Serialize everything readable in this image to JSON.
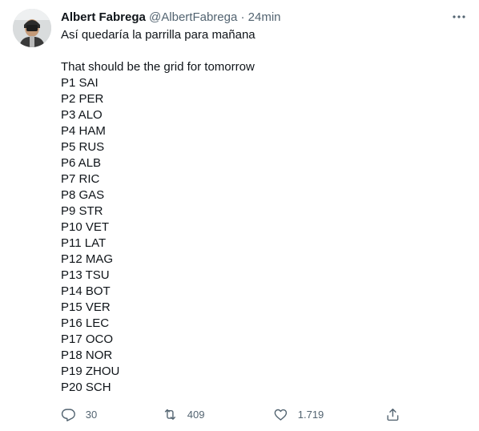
{
  "tweet": {
    "author": {
      "name": "Albert Fabrega",
      "handle": "@AlbertFabrega",
      "separator": "·",
      "time": "24min"
    },
    "text_line_1": "Así quedaría la parrilla para mañana",
    "text_line_2": "That should be the grid for tomorrow",
    "grid": [
      "P1 SAI",
      "P2 PER",
      "P3 ALO",
      "P4 HAM",
      "P5 RUS",
      "P6 ALB",
      "P7 RIC",
      "P8 GAS",
      "P9 STR",
      "P10 VET",
      "P11 LAT",
      "P12 MAG",
      "P13 TSU",
      "P14 BOT",
      "P15 VER",
      "P16 LEC",
      "P17 OCO",
      "P18 NOR",
      "P19 ZHOU",
      "P20 SCH"
    ],
    "actions": {
      "reply_count": "30",
      "retweet_count": "409",
      "like_count": "1.719"
    },
    "icons": {
      "more": "more-horizontal-icon",
      "reply": "reply-icon",
      "retweet": "retweet-icon",
      "like": "heart-icon",
      "share": "share-icon"
    },
    "colors": {
      "text": "#0f1419",
      "secondary": "#536471",
      "background": "#ffffff"
    }
  }
}
